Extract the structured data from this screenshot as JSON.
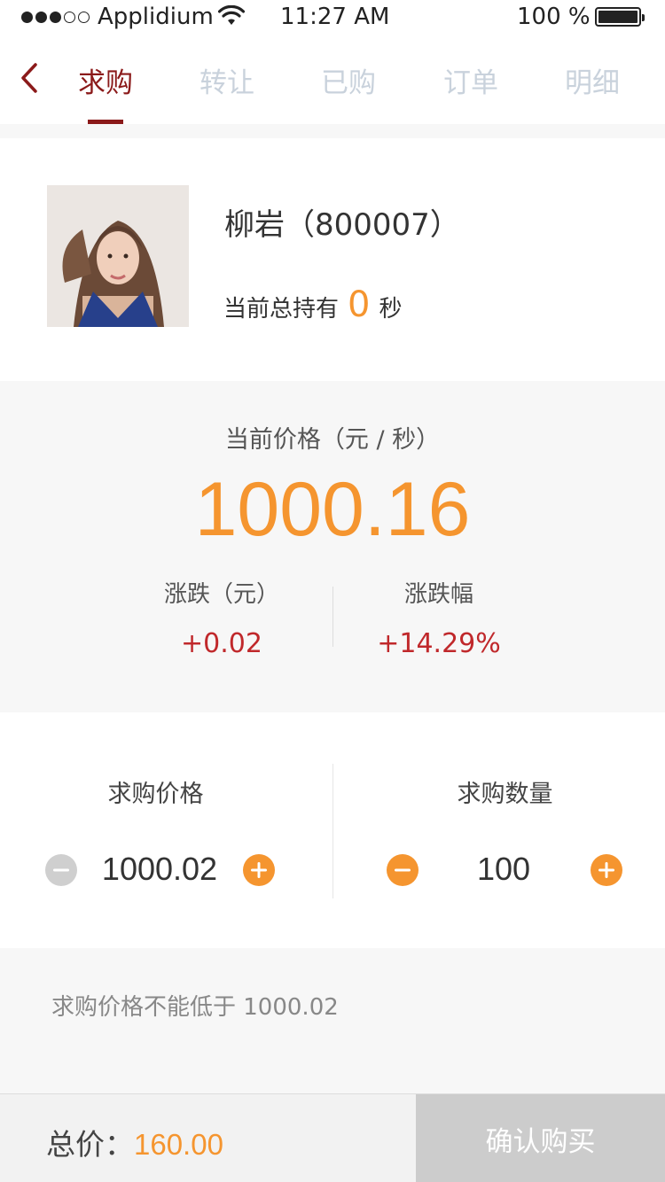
{
  "status_bar": {
    "carrier": "Applidium",
    "time": "11:27 AM",
    "battery_pct": "100 %",
    "signal_filled": 3,
    "signal_total": 5
  },
  "nav": {
    "tabs": [
      {
        "label": "求购",
        "active": true
      },
      {
        "label": "转让",
        "active": false
      },
      {
        "label": "已购",
        "active": false
      },
      {
        "label": "订单",
        "active": false
      },
      {
        "label": "明细",
        "active": false
      }
    ]
  },
  "profile": {
    "name": "柳岩（800007）",
    "holding_prefix": "当前总持有",
    "holding_value": "0",
    "holding_unit": "秒"
  },
  "price": {
    "label": "当前价格（元 / 秒）",
    "value": "1000.16",
    "change_label": "涨跌（元）",
    "change_value": "+0.02",
    "change_pct_label": "涨跌幅",
    "change_pct_value": "+14.29%"
  },
  "order": {
    "price_label": "求购价格",
    "price_value": "1000.02",
    "qty_label": "求购数量",
    "qty_value": "100"
  },
  "hint": "求购价格不能低于 1000.02",
  "bottom": {
    "total_label": "总价：",
    "total_value": "160.00",
    "confirm_label": "确认购买"
  },
  "colors": {
    "brand": "#8b1a1a",
    "accent": "#f5952f",
    "up": "#c0282b",
    "disabled": "#cccccc"
  }
}
